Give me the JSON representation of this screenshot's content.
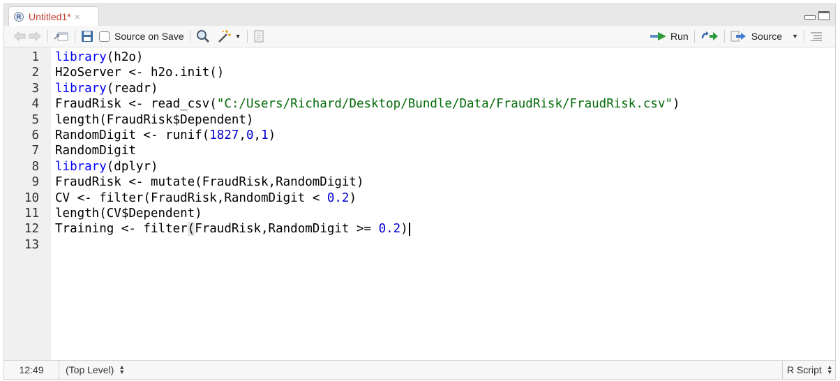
{
  "tab": {
    "title": "Untitled1*",
    "close": "×",
    "r_logo": "R"
  },
  "toolbar": {
    "source_on_save": "Source on Save",
    "run_label": "Run",
    "source_label": "Source"
  },
  "editor": {
    "line_numbers": [
      "1",
      "2",
      "3",
      "4",
      "5",
      "6",
      "7",
      "8",
      "9",
      "10",
      "11",
      "12",
      "13"
    ],
    "code_text": [
      "library(h2o)",
      "H2oServer <- h2o.init()",
      "library(readr)",
      "FraudRisk <- read_csv(\"C:/Users/Richard/Desktop/Bundle/Data/FraudRisk/FraudRisk.csv\")",
      "length(FraudRisk$Dependent)",
      "RandomDigit <- runif(1827,0,1)",
      "RandomDigit",
      "library(dplyr)",
      "FraudRisk <- mutate(FraudRisk,RandomDigit)",
      "CV <- filter(FraudRisk,RandomDigit < 0.2)",
      "length(CV$Dependent)",
      "Training <- filter(FraudRisk,RandomDigit >= 0.2)",
      ""
    ],
    "tokens": {
      "library": "library",
      "l1_rest": "(h2o)",
      "l2": "H2oServer <- h2o.init()",
      "l3_rest": "(readr)",
      "l4_a": "FraudRisk <- read_csv(",
      "l4_str": "\"C:/Users/Richard/Desktop/Bundle/Data/FraudRisk/FraudRisk.csv\"",
      "l4_b": ")",
      "l5": "length(FraudRisk$Dependent)",
      "l6_a": "RandomDigit <- runif(",
      "l6_n1": "1827",
      "l6_c1": ",",
      "l6_n2": "0",
      "l6_c2": ",",
      "l6_n3": "1",
      "l6_b": ")",
      "l7": "RandomDigit",
      "l8_rest": "(dplyr)",
      "l9": "FraudRisk <- mutate(FraudRisk,RandomDigit)",
      "l10_a": "CV <- filter(FraudRisk,RandomDigit < ",
      "l10_n": "0.2",
      "l10_b": ")",
      "l11": "length(CV$Dependent)",
      "l12_a": "Training <- filter",
      "l12_paren": "(",
      "l12_b": "FraudRisk,RandomDigit >= ",
      "l12_n": "0.2",
      "l12_c": ")"
    }
  },
  "status": {
    "position": "12:49",
    "scope": "(Top Level)",
    "language": "R Script"
  },
  "colors": {
    "keyword": "#0000ff",
    "string": "#036a07",
    "number": "#0000cd",
    "tab_title": "#c03a2b"
  }
}
